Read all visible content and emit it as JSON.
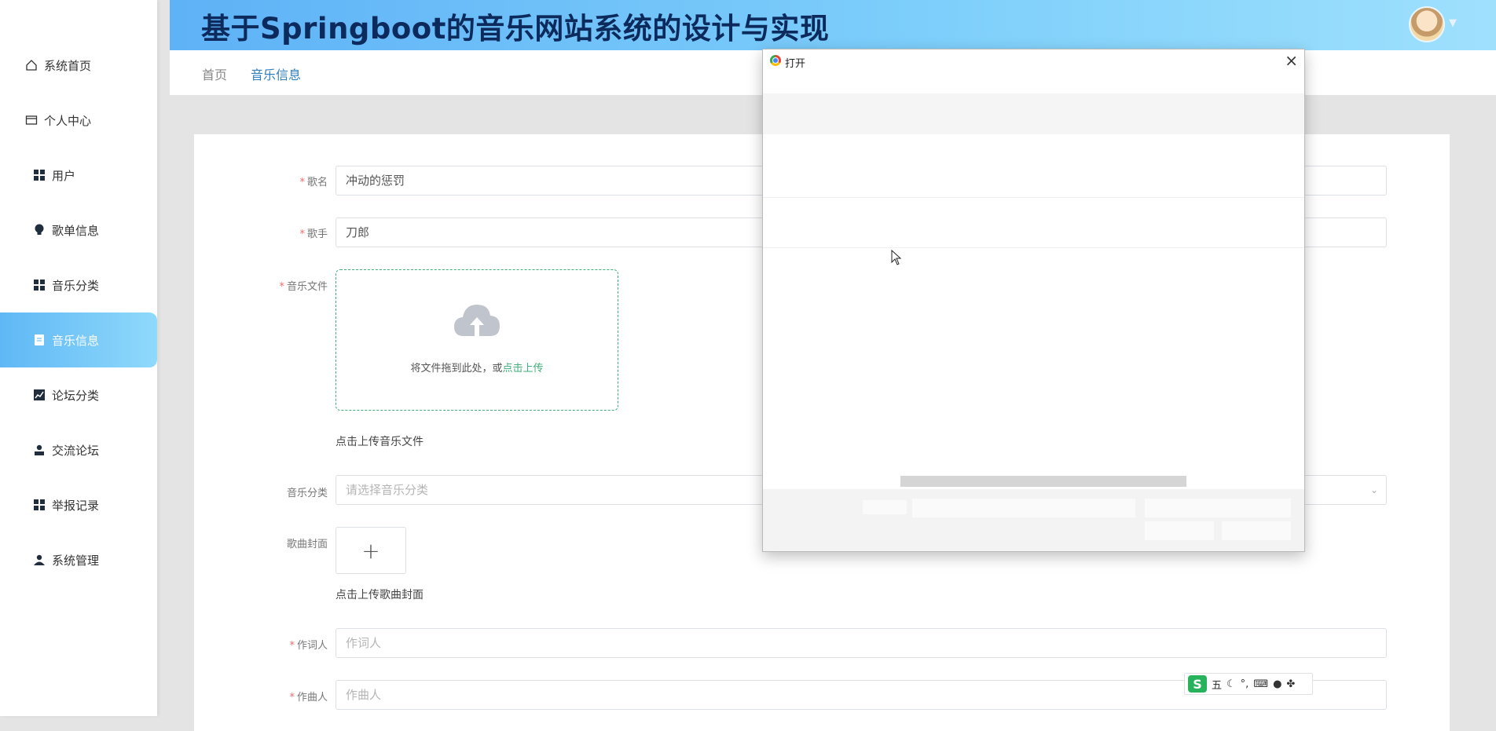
{
  "app": {
    "title": "基于Springboot的音乐网站系统的设计与实现"
  },
  "sidebar": {
    "items": [
      {
        "label": "系统首页",
        "icon": "home-icon"
      },
      {
        "label": "个人中心",
        "icon": "card-icon"
      },
      {
        "label": "用户",
        "icon": "grid-icon"
      },
      {
        "label": "歌单信息",
        "icon": "bulb-icon"
      },
      {
        "label": "音乐分类",
        "icon": "grid-icon"
      },
      {
        "label": "音乐信息",
        "icon": "document-icon",
        "active": true
      },
      {
        "label": "论坛分类",
        "icon": "chart-icon"
      },
      {
        "label": "交流论坛",
        "icon": "user-icon"
      },
      {
        "label": "举报记录",
        "icon": "grid-icon"
      },
      {
        "label": "系统管理",
        "icon": "user-icon"
      }
    ],
    "active_color": "#5fb8f5"
  },
  "breadcrumb": {
    "home": "首页",
    "current": "音乐信息"
  },
  "form": {
    "song_name": {
      "label": "歌名",
      "value": "冲动的惩罚"
    },
    "singer": {
      "label": "歌手",
      "value": "刀郎"
    },
    "music_file": {
      "label": "音乐文件",
      "drop_text": "将文件拖到此处，或",
      "click_text": "点击上传",
      "hint": "点击上传音乐文件"
    },
    "category": {
      "label": "音乐分类",
      "placeholder": "请选择音乐分类"
    },
    "cover": {
      "label": "歌曲封面",
      "plus": "+",
      "hint": "点击上传歌曲封面"
    },
    "lyricist": {
      "label": "作词人",
      "placeholder": "作词人"
    },
    "composer": {
      "label": "作曲人",
      "placeholder": "作曲人"
    },
    "required_mark": "*"
  },
  "dialog": {
    "title": "打开",
    "close": "×"
  },
  "ime": {
    "logo": "S",
    "mode": "五",
    "icons": [
      "moon-icon",
      "punctuation-icon",
      "keyboard-icon",
      "user-icon",
      "apps-icon"
    ]
  },
  "colors": {
    "header_gradient_start": "#5eb2f6",
    "header_gradient_end": "#9fe0fd",
    "accent_green": "#3fae7a",
    "required_red": "#f56c6c"
  }
}
